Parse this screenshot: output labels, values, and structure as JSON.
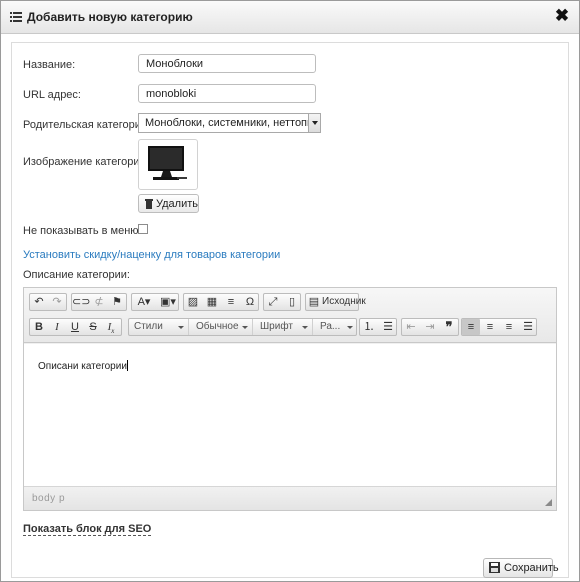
{
  "dialog": {
    "title": "Добавить новую категорию",
    "close": "✖"
  },
  "form": {
    "name_label": "Название:",
    "name_value": "Моноблоки",
    "url_label": "URL адрес:",
    "url_value": "monobloki",
    "parent_label": "Родительская категория:",
    "parent_value": "Моноблоки, системники, неттопы",
    "image_label": "Изображение категории:",
    "delete_label": "Удалить",
    "hide_label": "Не показывать в меню:",
    "hide_checked": false,
    "discount_link": "Установить скидку/наценку для товаров категории",
    "description_label": "Описание категории:"
  },
  "editor": {
    "source_label": "Исходник",
    "styles_label": "Стили",
    "format_label": "Обычное",
    "font_label": "Шрифт",
    "size_label": "Ра...",
    "content": "Описани категории",
    "path": "body  p"
  },
  "footer": {
    "seo_link": "Показать блок для SEO",
    "save_label": "Сохранить"
  },
  "colors": {
    "link": "#2a7bbf"
  }
}
